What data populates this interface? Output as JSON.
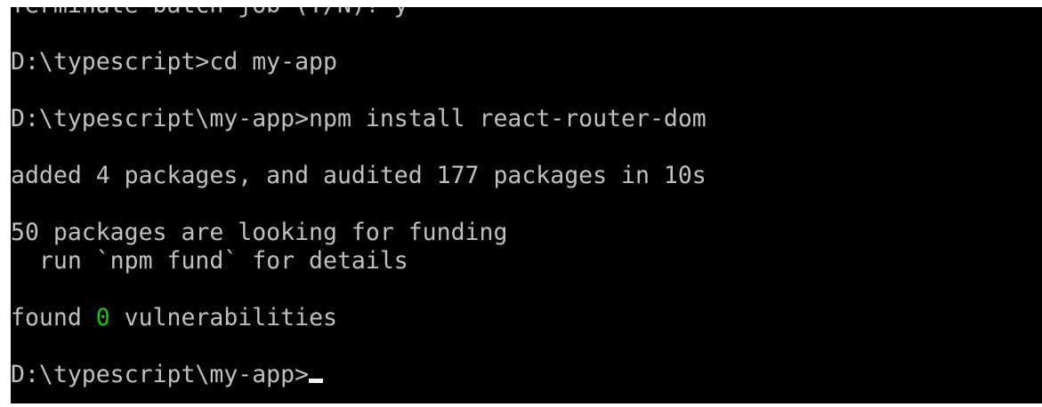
{
  "console": {
    "partial_line": "Terminate batch job (Y/N)? y",
    "line_cd": "D:\\typescript>cd my-app",
    "line_install": "D:\\typescript\\my-app>npm install react-router-dom",
    "line_added": "added 4 packages, and audited 177 packages in 10s",
    "line_funding": "50 packages are looking for funding",
    "line_fund_hint": "  run `npm fund` for details",
    "found_prefix": "found ",
    "found_count": "0",
    "found_suffix": " vulnerabilities",
    "prompt": "D:\\typescript\\my-app>",
    "colors": {
      "background": "#000000",
      "text": "#c0c0c0",
      "success": "#16c60c",
      "cursor": "#f2f2f2"
    }
  }
}
